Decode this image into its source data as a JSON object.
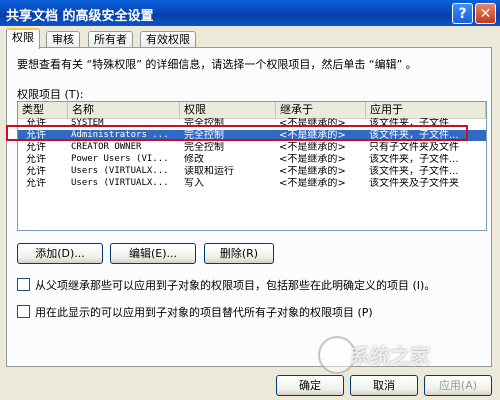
{
  "window": {
    "title": "共享文档 的高级安全设置",
    "help_glyph": "?",
    "close_glyph": "✕"
  },
  "tabs": [
    {
      "label": "权限"
    },
    {
      "label": "审核"
    },
    {
      "label": "所有者"
    },
    {
      "label": "有效权限"
    }
  ],
  "instruction": "要想查看有关 “特殊权限” 的详细信息，请选择一个权限项目，然后单击 “编辑” 。",
  "list": {
    "label": "权限项目 (T):",
    "columns": [
      "类型",
      "名称",
      "权限",
      "继承于",
      "应用于"
    ],
    "rows": [
      {
        "type": "允许",
        "name": "SYSTEM",
        "permission": "完全控制",
        "inherited_from": "<不是继承的>",
        "applies_to": "该文件夹，子文件..."
      },
      {
        "type": "允许",
        "name": "Administrators ...",
        "permission": "完全控制",
        "inherited_from": "<不是继承的>",
        "applies_to": "该文件夹，子文件..."
      },
      {
        "type": "允许",
        "name": "CREATOR OWNER",
        "permission": "完全控制",
        "inherited_from": "<不是继承的>",
        "applies_to": "只有子文件夹及文件"
      },
      {
        "type": "允许",
        "name": "Power Users (VI...",
        "permission": "修改",
        "inherited_from": "<不是继承的>",
        "applies_to": "该文件夹，子文件..."
      },
      {
        "type": "允许",
        "name": "Users (VIRTUALX...",
        "permission": "读取和运行",
        "inherited_from": "<不是继承的>",
        "applies_to": "该文件夹，子文件..."
      },
      {
        "type": "允许",
        "name": "Users (VIRTUALX...",
        "permission": "写入",
        "inherited_from": "<不是继承的>",
        "applies_to": "该文件夹及子文件夹"
      }
    ],
    "selected_index": 1
  },
  "buttons": {
    "add": "添加(D)...",
    "edit": "编辑(E)...",
    "remove": "删除(R)"
  },
  "checkboxes": {
    "inherit": "从父项继承那些可以应用到子对象的权限项目，包括那些在此明确定义的项目 (I)。",
    "replace": "用在此显示的可以应用到子对象的项目替代所有子对象的权限项目 (P)"
  },
  "footer": {
    "ok": "确定",
    "cancel": "取消",
    "apply": "应用(A)"
  },
  "watermark": "系统之家",
  "colors": {
    "selection": "#316ac5",
    "highlight_box": "#c8101e",
    "title_bar": "#0a5fd8"
  }
}
